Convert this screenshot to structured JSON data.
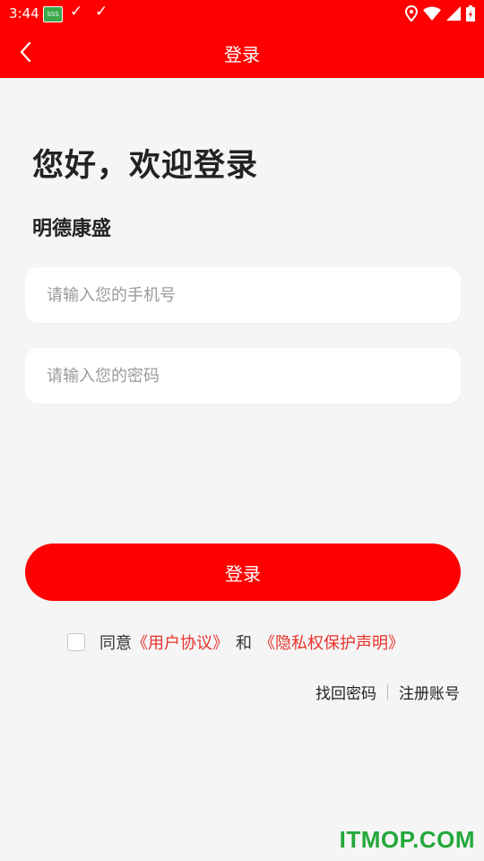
{
  "status_bar": {
    "time": "3:44",
    "app_icon_text": "SSS"
  },
  "navbar": {
    "title": "登录"
  },
  "welcome": {
    "heading": "您好，欢迎登录",
    "company": "明德康盛"
  },
  "form": {
    "phone_placeholder": "请输入您的手机号",
    "phone_value": "",
    "password_placeholder": "请输入您的密码",
    "password_value": "",
    "login_label": "登录"
  },
  "agreement": {
    "checked": false,
    "agree_text": "同意",
    "user_agreement": "《用户协议》",
    "and_text": "和",
    "privacy_policy": "《隐私权保护声明》"
  },
  "links": {
    "forgot_password": "找回密码",
    "register": "注册账号"
  },
  "watermark": "ITMOP.COM",
  "colors": {
    "primary": "#ff0000",
    "link": "#e8322c",
    "background": "#f5f5f5",
    "watermark": "#23a83a"
  }
}
